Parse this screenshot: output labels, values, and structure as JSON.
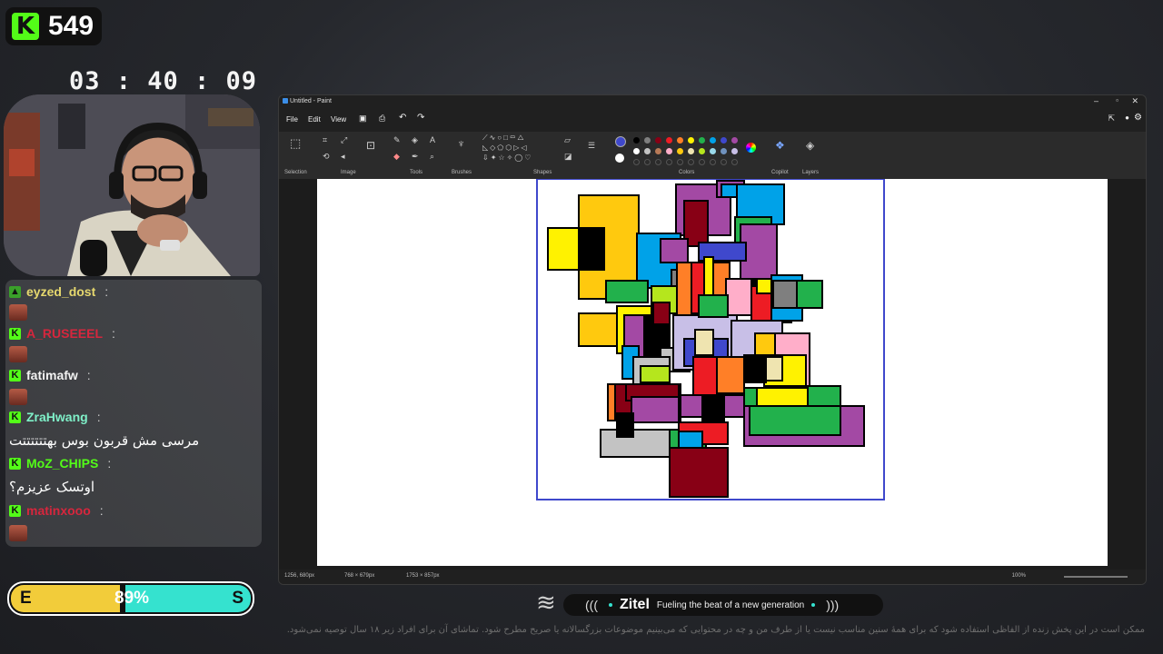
{
  "overlay": {
    "viewer_count": "549",
    "timer": "03 : 40 : 09",
    "energy_left": "E",
    "energy_percent": "89%",
    "energy_right": "S",
    "energy_level": 0.47
  },
  "chat": {
    "messages": [
      {
        "user": "eyzed_dost",
        "color": "#e6d86e",
        "text": ""
      },
      {
        "user": "A_RUSEEEL",
        "color": "#d7263d",
        "text": ""
      },
      {
        "user": "fatimafw",
        "color": "#f2f2f2",
        "text": ""
      },
      {
        "user": "ZraHwang",
        "color": "#7ff0c8",
        "text": "مرسی مش قربون بوس بهتتتتتتت"
      },
      {
        "user": "MoZ_CHIPS",
        "color": "#53fc18",
        "text": "اوتسک عزیزم؟"
      },
      {
        "user": "matinxooo",
        "color": "#d7263d",
        "text": ""
      }
    ],
    "separator": ":"
  },
  "paint": {
    "window_title": "Untitled - Paint",
    "menu": [
      "File",
      "Edit",
      "View"
    ],
    "groups": [
      "Selection",
      "Image",
      "Tools",
      "Brushes",
      "Shapes",
      "Colors",
      "Copilot",
      "Layers"
    ],
    "status": {
      "cursor": "1256, 680px",
      "selection": "768 × 679px",
      "size": "1753 × 857px",
      "zoom": "100%"
    },
    "palette": [
      "#000000",
      "#7f7f7f",
      "#880015",
      "#ed1c24",
      "#ff7f27",
      "#fff200",
      "#22b14c",
      "#00a2e8",
      "#3f48cc",
      "#a349a4",
      "#ffffff",
      "#c3c3c3",
      "#b97a57",
      "#ffaec9",
      "#ffc90e",
      "#efe4b0",
      "#b5e61d",
      "#99d9ea",
      "#7092be",
      "#c8bfe7"
    ],
    "primary_color": "#3f48cc",
    "secondary_color": "#ffffff"
  },
  "banner": {
    "brand": "Zitel",
    "tagline": "Fueling the beat of a new generation",
    "left_deco": "(((",
    "right_deco": ")))"
  },
  "footnote": "ممکن است در این پخش زنده از الفاظی استفاده شود که برای همهٔ سنین مناسب نیست یا از طرف من و چه در محتوایی که می‌بینیم موضوعات بزرگسالانه یا صریح مطرح شود. تماشای آن برای افراد زیر ۱۸ سال توصیه نمی‌شود."
}
